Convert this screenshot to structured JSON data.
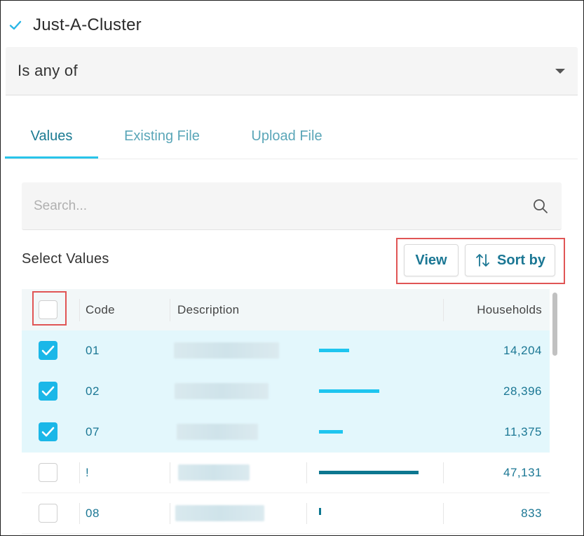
{
  "header": {
    "title": "Just-A-Cluster"
  },
  "operator": {
    "selected": "Is any of"
  },
  "tabs": [
    {
      "label": "Values",
      "active": true
    },
    {
      "label": "Existing File",
      "active": false
    },
    {
      "label": "Upload File",
      "active": false
    }
  ],
  "search": {
    "placeholder": "Search...",
    "value": ""
  },
  "values_section": {
    "label": "Select Values",
    "view_button": "View",
    "sort_button": "Sort by"
  },
  "table": {
    "columns": {
      "code": "Code",
      "description": "Description",
      "households": "Households"
    },
    "select_all_checked": false,
    "max_households": 47131,
    "rows": [
      {
        "code": "01",
        "households": "14,204",
        "households_value": 14204,
        "checked": true
      },
      {
        "code": "02",
        "households": "28,396",
        "households_value": 28396,
        "checked": true
      },
      {
        "code": "07",
        "households": "11,375",
        "households_value": 11375,
        "checked": true
      },
      {
        "code": "!",
        "households": "47,131",
        "households_value": 47131,
        "checked": false
      },
      {
        "code": "08",
        "households": "833",
        "households_value": 833,
        "checked": false
      }
    ]
  },
  "colors": {
    "accent": "#1ab7e8",
    "bar_selected": "#1ec5ef",
    "bar_unselected": "#0d7790",
    "link_teal": "#1b7794",
    "highlight_red": "#e05555"
  }
}
